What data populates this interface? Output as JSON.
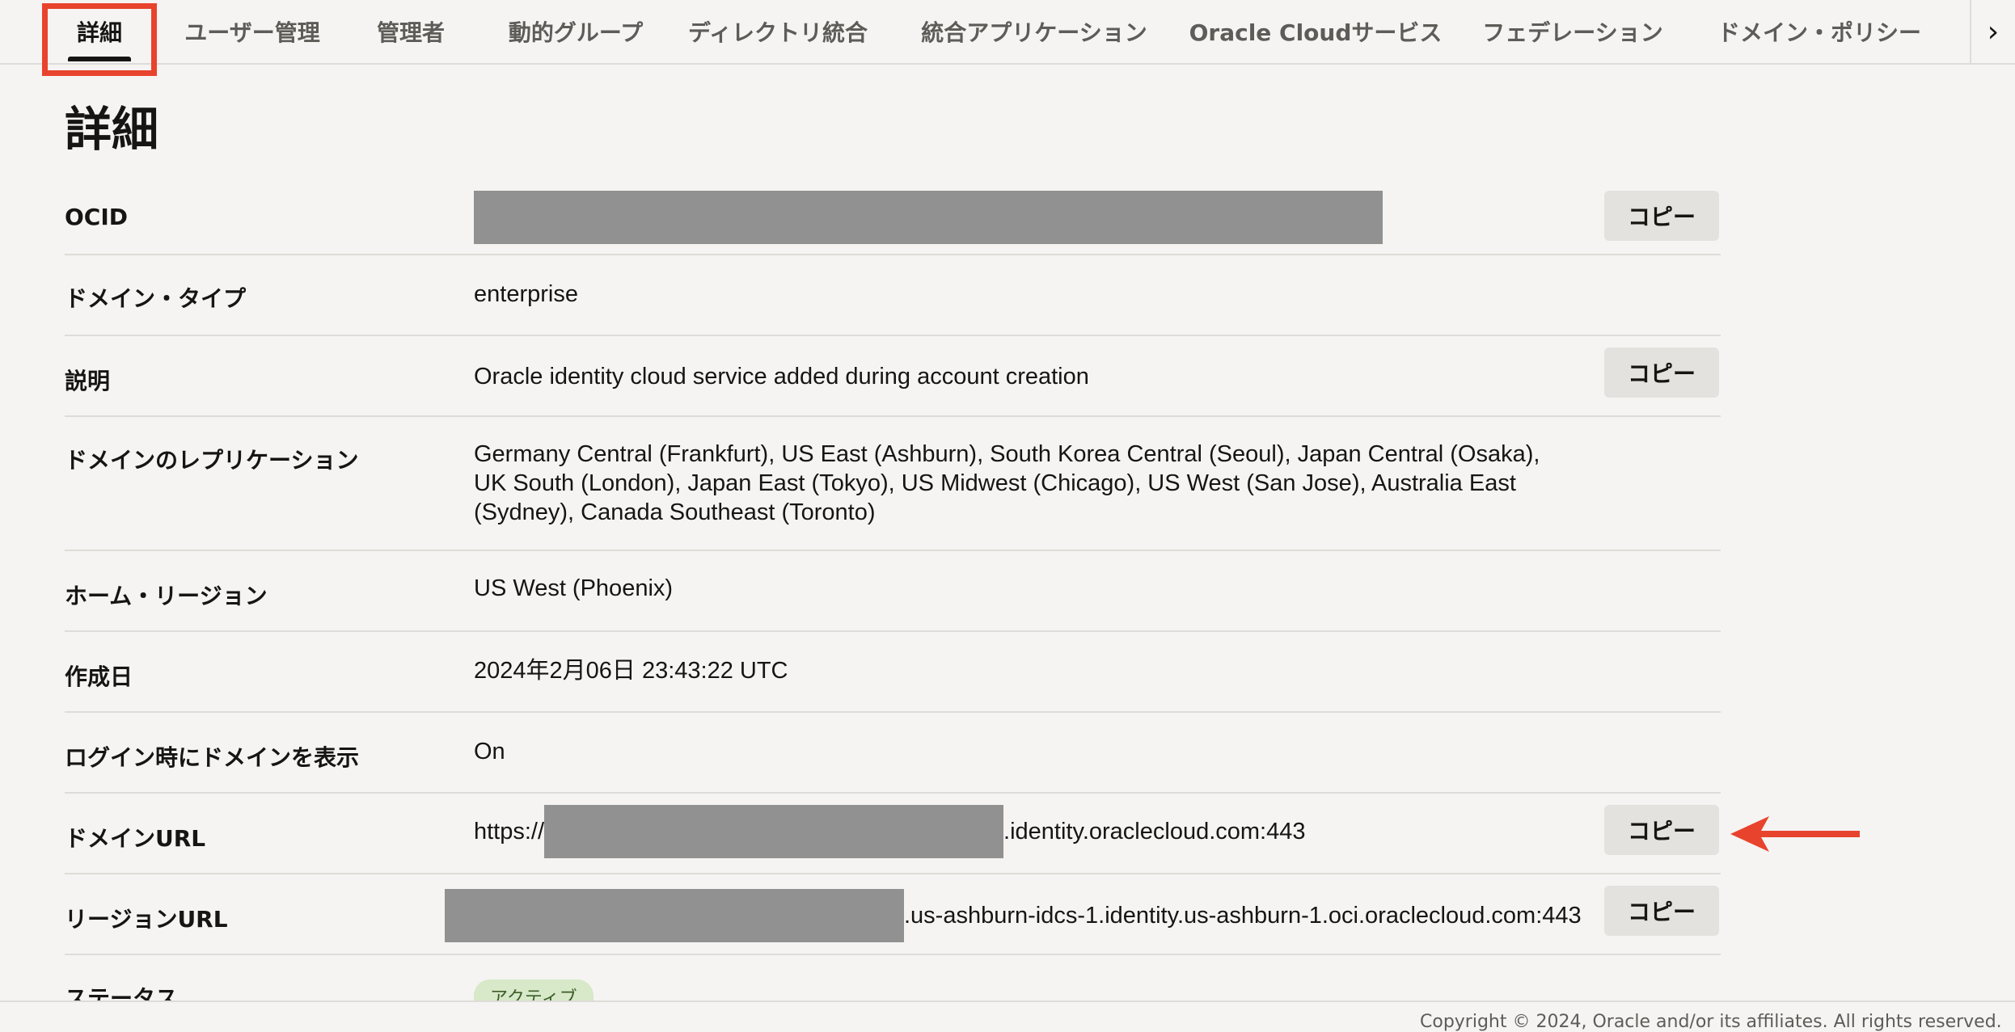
{
  "tabs": [
    {
      "label": "詳細"
    },
    {
      "label": "ユーザー管理"
    },
    {
      "label": "管理者"
    },
    {
      "label": "動的グループ"
    },
    {
      "label": "ディレクトリ統合"
    },
    {
      "label": "統合アプリケーション"
    },
    {
      "label": "Oracle Cloudサービス"
    },
    {
      "label": "フェデレーション"
    },
    {
      "label": "ドメイン・ポリシー"
    }
  ],
  "page_title": "詳細",
  "copy_label": "コピー",
  "rows": {
    "ocid": {
      "label": "OCID"
    },
    "domain_type": {
      "label": "ドメイン・タイプ",
      "value": "enterprise"
    },
    "description": {
      "label": "説明",
      "value": "Oracle identity cloud service added during account creation"
    },
    "replication": {
      "label": "ドメインのレプリケーション",
      "value": "Germany Central (Frankfurt), US East (Ashburn), South Korea Central (Seoul), Japan Central (Osaka), UK South (London), Japan East (Tokyo), US Midwest (Chicago), US West (San Jose), Australia East (Sydney), Canada Southeast (Toronto)"
    },
    "home_region": {
      "label": "ホーム・リージョン",
      "value": "US West (Phoenix)"
    },
    "created": {
      "label": "作成日",
      "value": "2024年2月06日 23:43:22 UTC"
    },
    "show_domain": {
      "label": "ログイン時にドメインを表示",
      "value": "On"
    },
    "domain_url": {
      "label": "ドメインURL",
      "prefix": "https://",
      "suffix": ".identity.oraclecloud.com:443"
    },
    "region_url": {
      "label": "リージョンURL",
      "suffix": ".us-ashburn-idcs-1.identity.us-ashburn-1.oci.oraclecloud.com:443"
    },
    "status": {
      "label": "ステータス",
      "value": "アクティブ"
    }
  },
  "footer": {
    "text": "Copyright © 2024, Oracle and/or its affiliates. All rights reserved."
  },
  "colors": {
    "highlight": "#e8432d",
    "redaction": "#919191",
    "status_badge": "#d7e9c8"
  },
  "icons": {
    "tab_scroll": "chevron-right-icon",
    "annotation": "red-arrow"
  }
}
